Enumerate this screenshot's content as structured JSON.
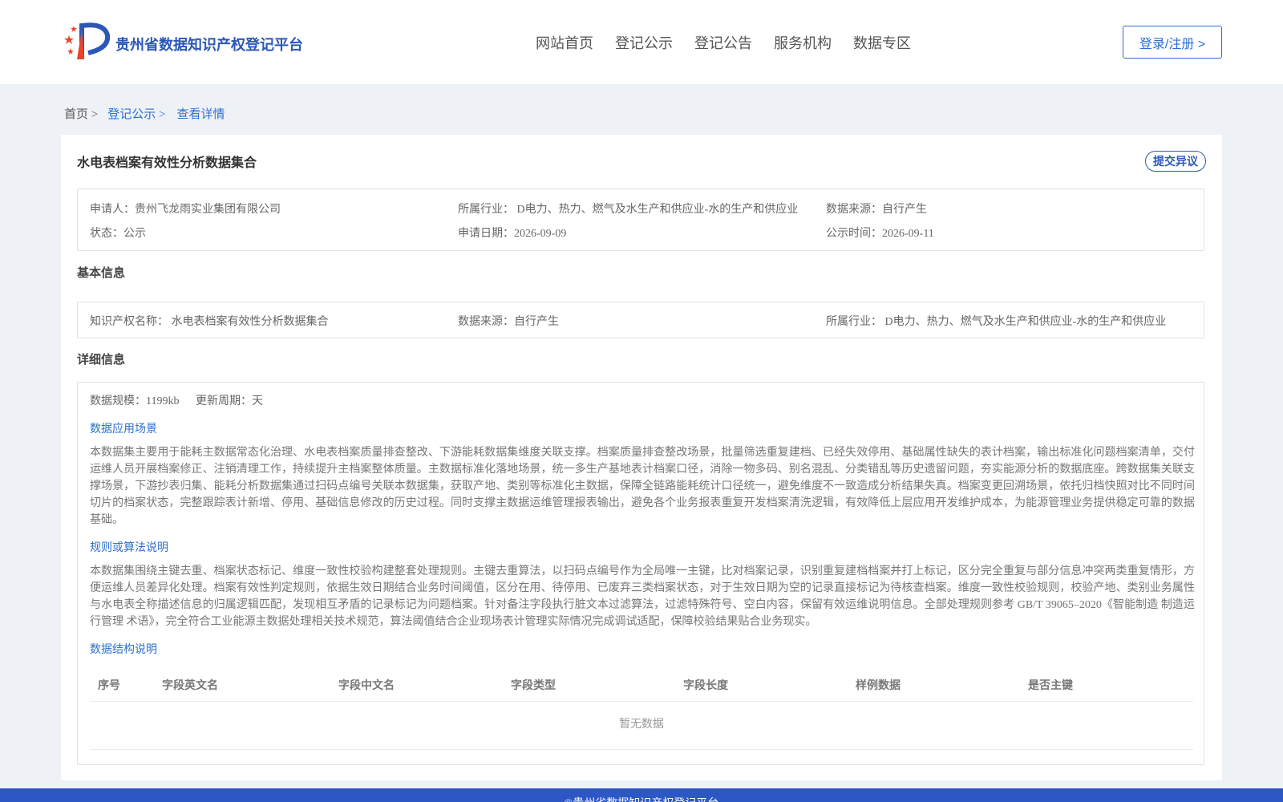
{
  "header": {
    "brand": "贵州省数据知识产权登记平台",
    "nav": [
      "网站首页",
      "登记公示",
      "登记公告",
      "服务机构",
      "数据专区"
    ],
    "login_label": "登录/注册 >"
  },
  "breadcrumb": {
    "home": "首页 >",
    "list": "登记公示 >",
    "current": "查看详情"
  },
  "record": {
    "title": "水电表档案有效性分析数据集合",
    "objection_label": "提交异议",
    "applicant": "申请人：贵州飞龙雨实业集团有限公司",
    "industry": "所属行业： D电力、热力、燃气及水生产和供应业-水的生产和供应业",
    "source": "数据来源：自行产生",
    "status": "状态：公示",
    "apply_date": "申请日期：2026-09-09",
    "publish_date": "公示时间：2026-09-11"
  },
  "basic_info": {
    "heading": "基本信息",
    "ip_name": "知识产权名称： 水电表档案有效性分析数据集合",
    "source": "数据来源：自行产生",
    "industry": "所属行业： D电力、热力、燃气及水生产和供应业-水的生产和供应业"
  },
  "detail_info": {
    "heading": "详细信息",
    "scale": "数据规模：1199kb",
    "cycle": "更新周期：天",
    "scenario_title": "数据应用场景",
    "scenario_text": "本数据集主要用于能耗主数据常态化治理、水电表档案质量排查整改、下游能耗数据集维度关联支撑。档案质量排查整改场景，批量筛选重复建档、已经失效停用、基础属性缺失的表计档案，输出标准化问题档案清单，交付运维人员开展档案修正、注销清理工作，持续提升主档案整体质量。主数据标准化落地场景，统一多生产基地表计档案口径，消除一物多码、别名混乱、分类错乱等历史遗留问题，夯实能源分析的数据底座。跨数据集关联支撑场景，下游抄表归集、能耗分析数据集通过扫码点编号关联本数据集，获取产地、类别等标准化主数据，保障全链路能耗统计口径统一，避免维度不一致造成分析结果失真。档案变更回溯场景，依托归档快照对比不同时间切片的档案状态，完整跟踪表计新增、停用、基础信息修改的历史过程。同时支撑主数据运维管理报表输出，避免各个业务报表重复开发档案清洗逻辑，有效降低上层应用开发维护成本，为能源管理业务提供稳定可靠的数据基础。",
    "rules_title": "规则或算法说明",
    "rules_text": "本数据集围绕主键去重、档案状态标记、维度一致性校验构建整套处理规则。主键去重算法，以扫码点编号作为全局唯一主键，比对档案记录，识别重复建档档案并打上标记，区分完全重复与部分信息冲突两类重复情形，方便运维人员差异化处理。档案有效性判定规则，依据生效日期结合业务时间阈值，区分在用、待停用、已废弃三类档案状态，对于生效日期为空的记录直接标记为待核查档案。维度一致性校验规则，校验产地、类别业务属性与水电表全称描述信息的归属逻辑匹配，发现相互矛盾的记录标记为问题档案。针对备注字段执行脏文本过滤算法，过滤特殊符号、空白内容，保留有效运维说明信息。全部处理规则参考 GB/T 39065–2020《智能制造 制造运行管理 术语》，完全符合工业能源主数据处理相关技术规范，算法阈值结合企业现场表计管理实际情况完成调试适配，保障校验结果贴合业务现实。",
    "structure_title": "数据结构说明",
    "columns": [
      "序号",
      "字段英文名",
      "字段中文名",
      "字段类型",
      "字段长度",
      "样例数据",
      "是否主键"
    ],
    "empty_text": "暂无数据"
  },
  "footer": {
    "text": "©贵州省数据知识产权登记平台"
  },
  "colors": {
    "brand_blue": "#2c57b8",
    "link_blue": "#2c70d0",
    "page_bg": "#eef2f6",
    "footer_bg": "#2c57c4"
  }
}
